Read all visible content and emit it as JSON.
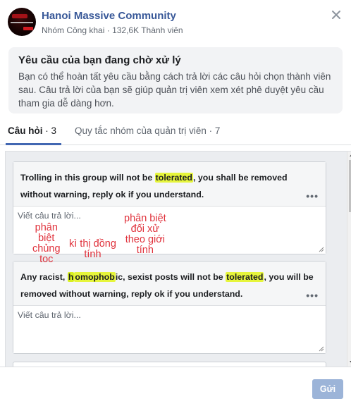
{
  "group": {
    "name": "Hanoi Massive Community",
    "privacy": "Nhóm Công khai",
    "separator": "·",
    "members": "132,6K Thành viên"
  },
  "notice": {
    "title": "Yêu cầu của bạn đang chờ xử lý",
    "body": "Bạn có thể hoàn tất yêu cầu bằng cách trả lời các câu hỏi chọn thành viên sau. Câu trả lời của bạn sẽ giúp quản trị viên xem xét phê duyệt yêu cầu tham gia dễ dàng hơn."
  },
  "tabs": {
    "questions_label": "Câu hỏi",
    "questions_count": "· 3",
    "rules_label": "Quy tắc nhóm của quản trị viên · 7"
  },
  "questions": [
    {
      "p1": "Trolling in this group will not be ",
      "h1": "tolerated",
      "p2": ", you shall be removed without warning, reply ok if you understand.",
      "answer_value": "",
      "placeholder": "Viết câu trả lời..."
    },
    {
      "p1": "Any racist, ",
      "h0a": "h",
      "h0b": "omophob",
      "p0": "ic, sexist posts will not be ",
      "h1": "tolerated",
      "p2": ", you will be removed without warning, reply ok if you understand.",
      "answer_value": "",
      "placeholder": "Viết câu trả lời..."
    }
  ],
  "annotations": {
    "racial_discrimination": "phân\nbiệt\nchủng\ntoc",
    "homophobia": "kì thị đồng\ntính",
    "gender_discrimination": "phân biệt\nđối xử\ntheo giới\ntính"
  },
  "footer": {
    "submit_label": "Gửi"
  },
  "more_icon": "more-horizontal-icon",
  "close_icon": "close-icon",
  "colors": {
    "link": "#385898",
    "accent": "#4267b2",
    "highlight": "#e6f53b",
    "submit_disabled": "#9cb4d8",
    "annotation": "#e0323c"
  }
}
